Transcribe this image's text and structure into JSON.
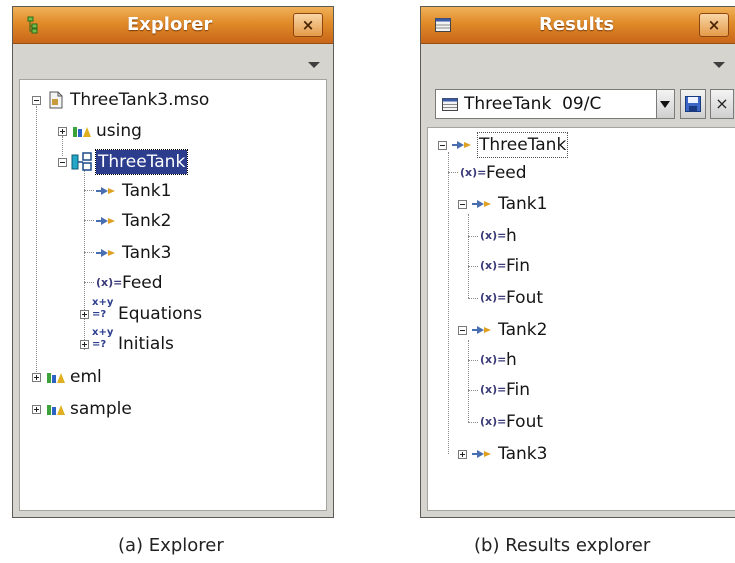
{
  "explorer": {
    "title": "Explorer",
    "close_label": "×",
    "tree": {
      "root": "ThreeTank3.mso",
      "using": "using",
      "model": "ThreeTank",
      "tank1": "Tank1",
      "tank2": "Tank2",
      "tank3": "Tank3",
      "feed": "Feed",
      "equations": "Equations",
      "initials": "Initials",
      "eml": "eml",
      "sample": "sample"
    },
    "caption": "(a) Explorer"
  },
  "results": {
    "title": "Results",
    "close_label": "×",
    "selector_text": "ThreeTank  09/C",
    "clear_label": "×",
    "tree": {
      "root": "ThreeTank",
      "feed": "Feed",
      "tank1": "Tank1",
      "t1_h": "h",
      "t1_fin": "Fin",
      "t1_fout": "Fout",
      "tank2": "Tank2",
      "t2_h": "h",
      "t2_fin": "Fin",
      "t2_fout": "Fout",
      "tank3": "Tank3"
    },
    "caption": "(b) Results explorer"
  },
  "colors": {
    "titlebar": "#e08a28",
    "selection": "#2b3d8c",
    "panel_bg": "#d6d4ce"
  },
  "icons": [
    "hierarchy-icon",
    "file-icon",
    "library-icon",
    "model-icon",
    "device-icon",
    "variable-icon",
    "equation-icon",
    "table-icon",
    "save-icon"
  ]
}
